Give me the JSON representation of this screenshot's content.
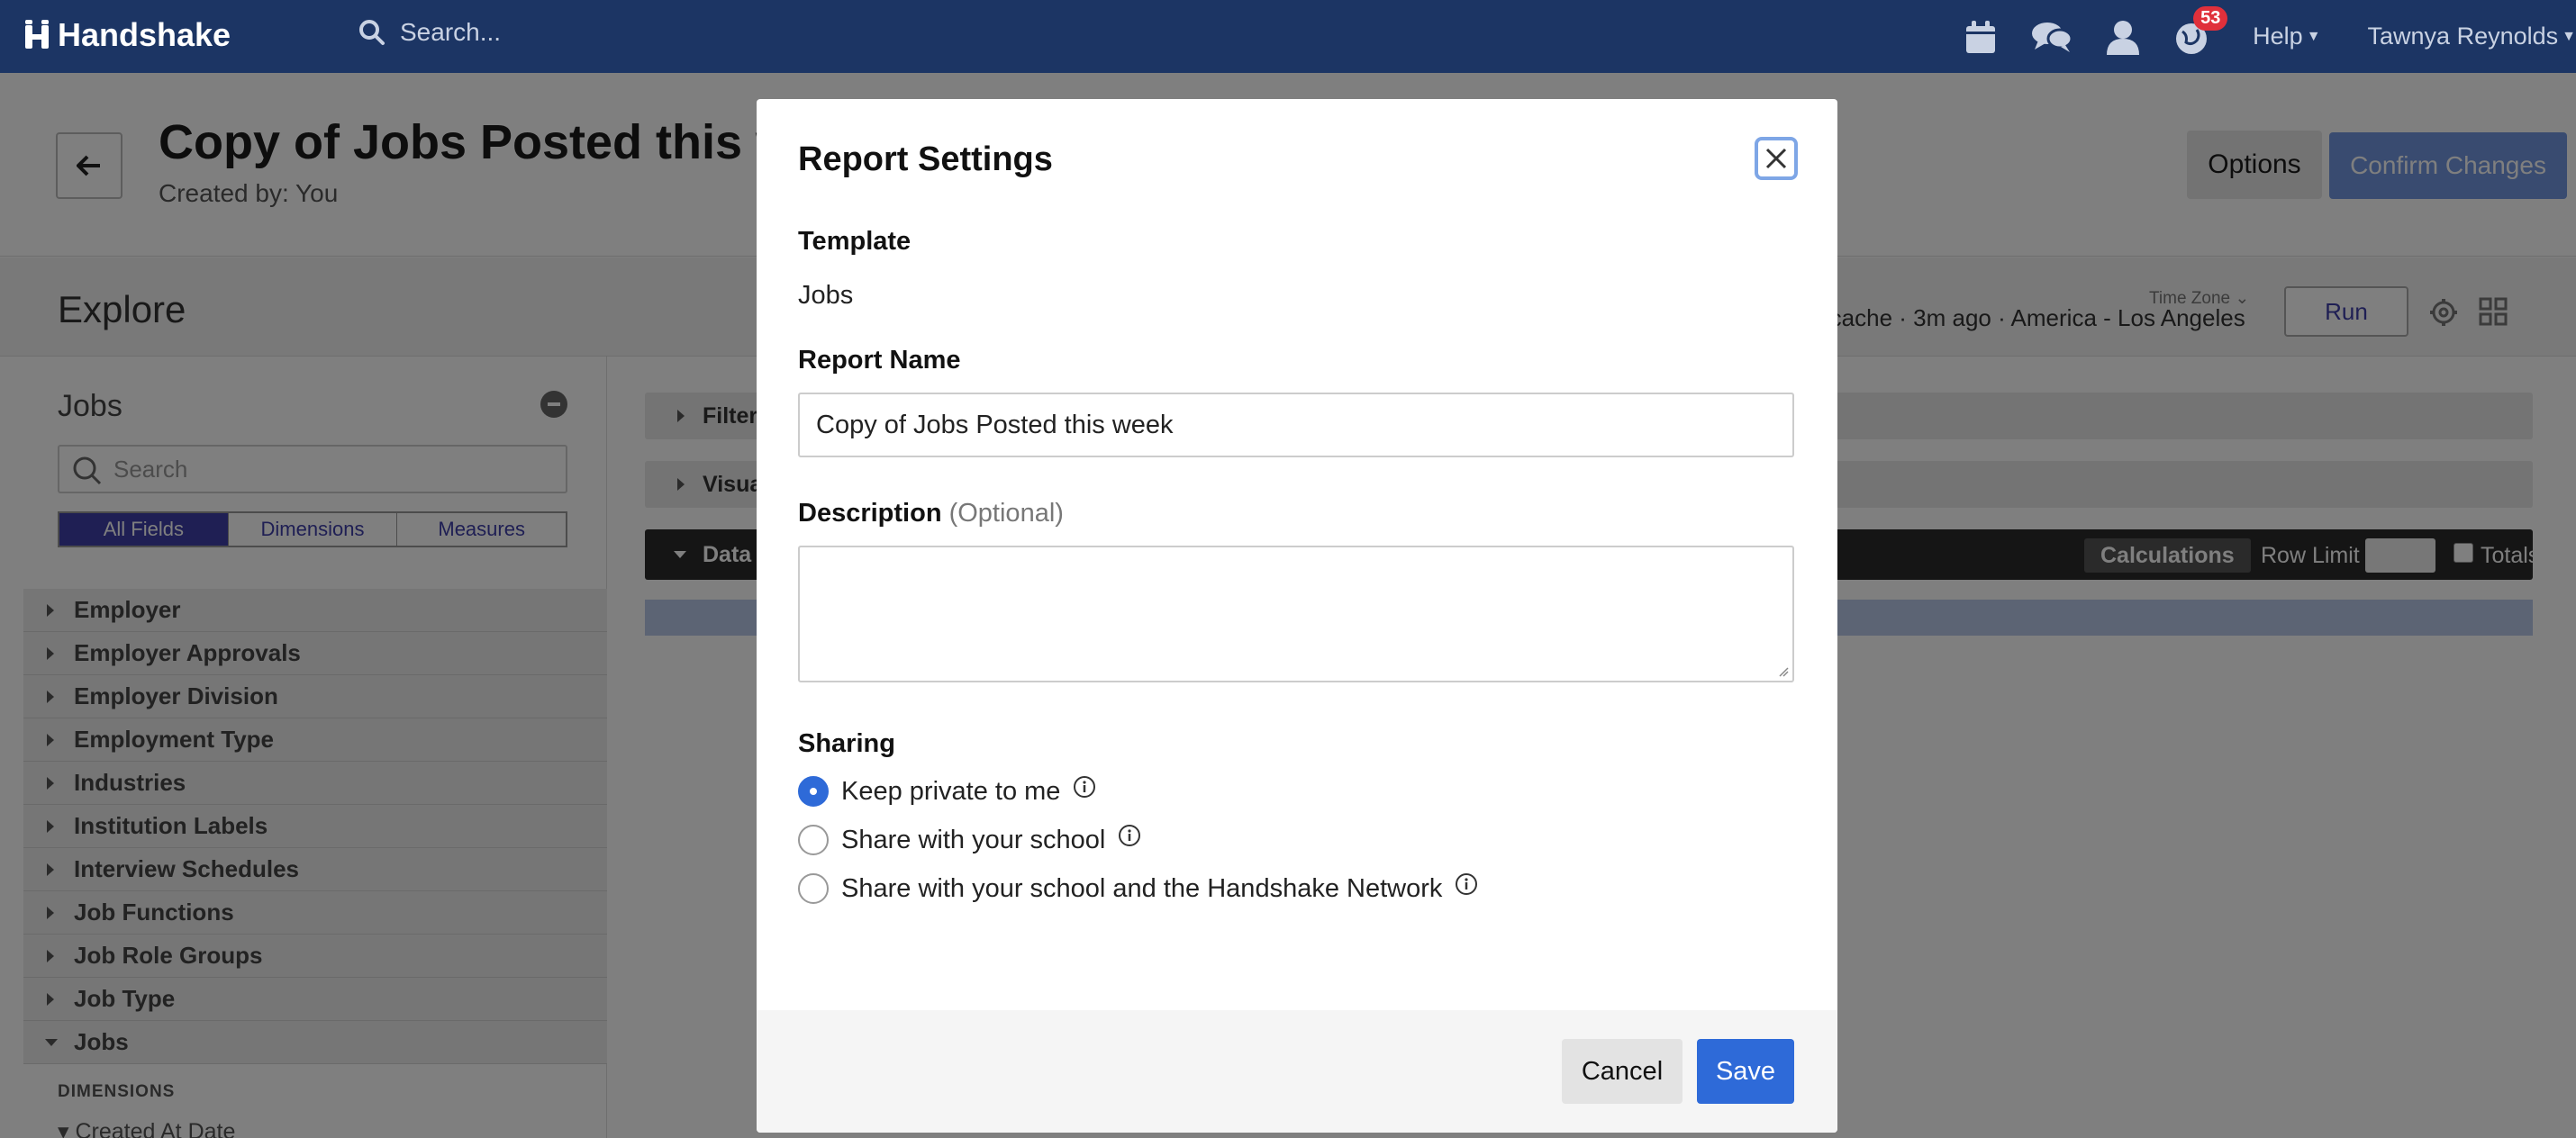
{
  "topnav": {
    "brand": "Handshake",
    "search_placeholder": "Search...",
    "notification_count": "53",
    "help_label": "Help",
    "user_name": "Tawnya Reynolds",
    "icons": [
      "calendar-icon",
      "chat-icon",
      "user-icon",
      "globe-icon"
    ]
  },
  "page": {
    "report_title": "Copy of Jobs Posted this week",
    "created_by": "Created by: You",
    "options_label": "Options",
    "confirm_label": "Confirm Changes"
  },
  "explore": {
    "title": "Explore",
    "cache_info": "n cache · 3m ago · America - Los Angeles",
    "timezone_label": "Time Zone",
    "run_label": "Run"
  },
  "left_panel": {
    "title": "Jobs",
    "search_placeholder": "Search",
    "tabs": [
      "All Fields",
      "Dimensions",
      "Measures"
    ],
    "fields": [
      "Employer",
      "Employer Approvals",
      "Employer Division",
      "Employment Type",
      "Industries",
      "Institution Labels",
      "Interview Schedules",
      "Job Functions",
      "Job Role Groups",
      "Job Type",
      "Jobs"
    ],
    "dimensions_label": "DIMENSIONS",
    "created_at_label": "Created At Date"
  },
  "right_panel": {
    "filter_label": "Filter",
    "visual_label": "Visua",
    "data_label": "Data",
    "calculations_label": "Calculations",
    "row_limit_label": "Row Limit",
    "totals_label": "Totals"
  },
  "modal": {
    "title": "Report Settings",
    "template_label": "Template",
    "template_value": "Jobs",
    "report_name_label": "Report Name",
    "report_name_value": "Copy of Jobs Posted this week",
    "description_label": "Description",
    "description_optional": "(Optional)",
    "sharing_label": "Sharing",
    "sharing_options": [
      {
        "label": "Keep private to me",
        "checked": true
      },
      {
        "label": "Share with your school",
        "checked": false
      },
      {
        "label": "Share with your school and the Handshake Network",
        "checked": false
      }
    ],
    "cancel_label": "Cancel",
    "save_label": "Save"
  },
  "colors": {
    "nav_bg": "#1c3564",
    "primary": "#2e6ad8",
    "accent_purple": "#3e3ea8",
    "badge_red": "#e0303b"
  }
}
